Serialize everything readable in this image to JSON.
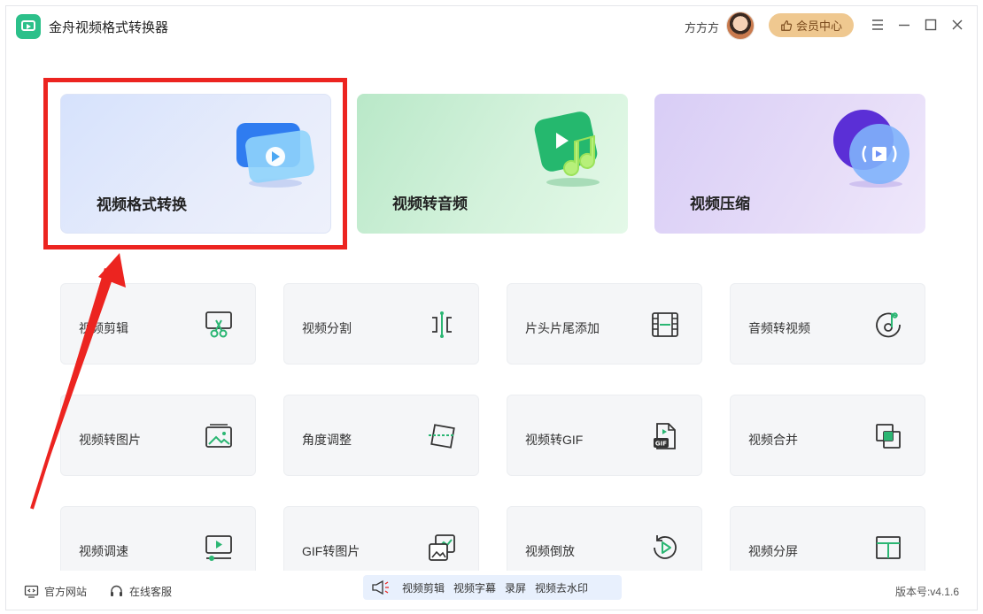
{
  "app": {
    "title": "金舟视频格式转换器",
    "user_name": "方方方",
    "vip_label": "会员中心"
  },
  "colors": {
    "accent_green": "#2cc08a",
    "highlight_red": "#ec2420",
    "vip_gold": "#efc890",
    "icon_green": "#2bb673"
  },
  "feature_cards": [
    {
      "label": "视频格式转换",
      "icon": "video-convert-icon"
    },
    {
      "label": "视频转音频",
      "icon": "video-to-audio-icon"
    },
    {
      "label": "视频压缩",
      "icon": "video-compress-icon"
    }
  ],
  "tools": [
    {
      "label": "视频剪辑",
      "icon": "scissors-icon"
    },
    {
      "label": "视频分割",
      "icon": "split-icon"
    },
    {
      "label": "片头片尾添加",
      "icon": "film-icon"
    },
    {
      "label": "音频转视频",
      "icon": "audio-disc-icon"
    },
    {
      "label": "视频转图片",
      "icon": "image-icon"
    },
    {
      "label": "角度调整",
      "icon": "rotate-frame-icon"
    },
    {
      "label": "视频转GIF",
      "icon": "gif-file-icon"
    },
    {
      "label": "视频合并",
      "icon": "merge-icon"
    },
    {
      "label": "视频调速",
      "icon": "speed-icon"
    },
    {
      "label": "GIF转图片",
      "icon": "gif-to-image-icon"
    },
    {
      "label": "视频倒放",
      "icon": "reverse-play-icon"
    },
    {
      "label": "视频分屏",
      "icon": "split-screen-icon"
    }
  ],
  "footer": {
    "website": "官方网站",
    "support": "在线客服",
    "quick_links": [
      "视频剪辑",
      "视频字幕",
      "录屏",
      "视频去水印"
    ],
    "version": "版本号:v4.1.6"
  }
}
